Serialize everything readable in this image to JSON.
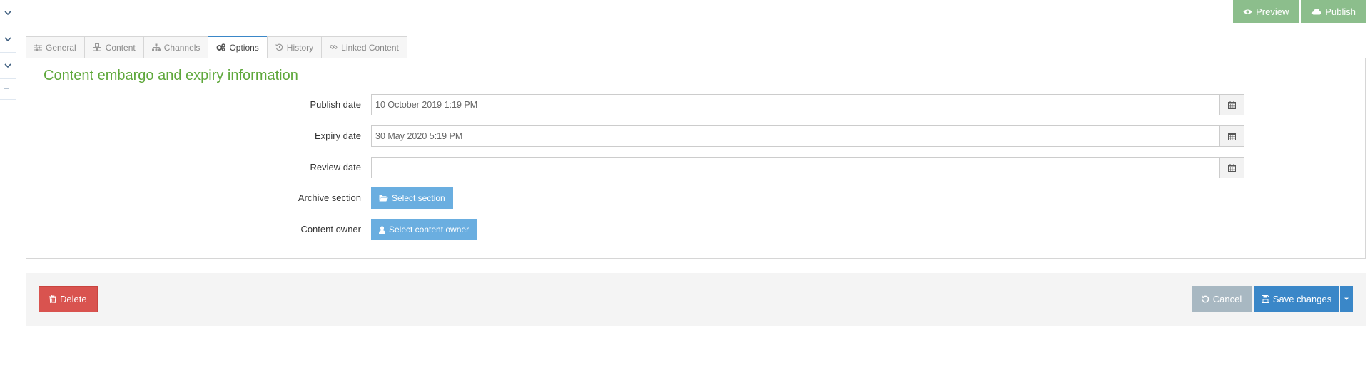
{
  "top_actions": {
    "preview": "Preview",
    "publish": "Publish"
  },
  "tabs": [
    {
      "label": "General",
      "icon": "sliders-icon"
    },
    {
      "label": "Content",
      "icon": "cubes-icon"
    },
    {
      "label": "Channels",
      "icon": "sitemap-icon"
    },
    {
      "label": "Options",
      "icon": "cogs-icon",
      "active": true
    },
    {
      "label": "History",
      "icon": "history-icon"
    },
    {
      "label": "Linked Content",
      "icon": "link-icon"
    }
  ],
  "section": {
    "title": "Content embargo and expiry information"
  },
  "fields": {
    "publish_date": {
      "label": "Publish date",
      "value": "10 October 2019 1:19 PM"
    },
    "expiry_date": {
      "label": "Expiry date",
      "value": "30 May 2020 5:19 PM"
    },
    "review_date": {
      "label": "Review date",
      "value": ""
    },
    "archive_section": {
      "label": "Archive section",
      "button": "Select section"
    },
    "content_owner": {
      "label": "Content owner",
      "button": "Select content owner"
    }
  },
  "footer": {
    "delete": "Delete",
    "cancel": "Cancel",
    "save": "Save changes"
  },
  "colors": {
    "accent_blue": "#3a87c8",
    "light_blue_button": "#6aaee0",
    "green_button": "#8cbe8c",
    "section_title": "#5fa83c",
    "delete_red": "#d9534f",
    "cancel_grey": "#a8b8c2"
  }
}
